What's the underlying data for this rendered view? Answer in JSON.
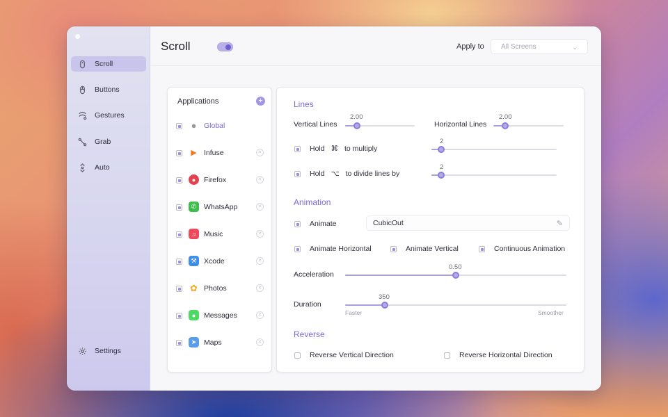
{
  "sidebar": {
    "items": [
      {
        "label": "Scroll",
        "icon": "mouse-icon",
        "active": true
      },
      {
        "label": "Buttons",
        "icon": "mouse-button-icon",
        "active": false
      },
      {
        "label": "Gestures",
        "icon": "gesture-icon",
        "active": false
      },
      {
        "label": "Grab",
        "icon": "grab-icon",
        "active": false
      },
      {
        "label": "Auto",
        "icon": "auto-scroll-icon",
        "active": false
      }
    ],
    "settings": {
      "label": "Settings",
      "icon": "gear-icon"
    }
  },
  "header": {
    "title": "Scroll",
    "enabled": true,
    "apply_to_label": "Apply to",
    "apply_to_value": "All Screens"
  },
  "applications": {
    "title": "Applications",
    "items": [
      {
        "name": "Global",
        "checked": true,
        "selected": true,
        "icon": "apple-icon",
        "color": "#9a9aa2"
      },
      {
        "name": "Infuse",
        "checked": true,
        "selected": false,
        "icon": "infuse-icon",
        "color": "#f07a24"
      },
      {
        "name": "Firefox",
        "checked": true,
        "selected": false,
        "icon": "firefox-icon",
        "color": "#e3414f"
      },
      {
        "name": "WhatsApp",
        "checked": true,
        "selected": false,
        "icon": "whatsapp-icon",
        "color": "#3ebd4c"
      },
      {
        "name": "Music",
        "checked": true,
        "selected": false,
        "icon": "music-icon",
        "color": "#f04a5a"
      },
      {
        "name": "Xcode",
        "checked": true,
        "selected": false,
        "icon": "xcode-icon",
        "color": "#3f8ee8"
      },
      {
        "name": "Photos",
        "checked": true,
        "selected": false,
        "icon": "photos-icon",
        "color": "#f5a623"
      },
      {
        "name": "Messages",
        "checked": true,
        "selected": false,
        "icon": "messages-icon",
        "color": "#4cd964"
      },
      {
        "name": "Maps",
        "checked": true,
        "selected": false,
        "icon": "maps-icon",
        "color": "#5a9de8"
      }
    ]
  },
  "lines": {
    "section_title": "Lines",
    "vertical": {
      "label": "Vertical Lines",
      "value": "2.00",
      "fraction": 0.17
    },
    "horizontal": {
      "label": "Horizontal Lines",
      "value": "2.00",
      "fraction": 0.17
    },
    "hold_multiply": {
      "hold": "Hold",
      "key": "⌘",
      "rest": "to multiply",
      "value": "2",
      "fraction": 0.08,
      "checked": true
    },
    "hold_divide": {
      "hold": "Hold",
      "key": "⌥",
      "rest": "to divide lines by",
      "value": "2",
      "fraction": 0.08,
      "checked": true
    }
  },
  "animation": {
    "section_title": "Animation",
    "animate": {
      "label": "Animate",
      "checked": true,
      "curve": "CubicOut"
    },
    "animate_horizontal": {
      "label": "Animate Horizontal",
      "checked": true
    },
    "animate_vertical": {
      "label": "Animate Vertical",
      "checked": true
    },
    "continuous": {
      "label": "Continuous Animation",
      "checked": true
    },
    "acceleration": {
      "label": "Acceleration",
      "value": "0.50",
      "fraction": 0.5
    },
    "duration": {
      "label": "Duration",
      "value": "350",
      "fraction": 0.18,
      "min_label": "Faster",
      "max_label": "Smoother"
    }
  },
  "reverse": {
    "section_title": "Reverse",
    "vertical": {
      "label": "Reverse Vertical Direction",
      "checked": false
    },
    "horizontal": {
      "label": "Reverse Horizontal Direction",
      "checked": false
    }
  },
  "colors": {
    "accent": "#7a6bd6",
    "slider_fill": "#a89fe2",
    "sidebar_active": "#c9c4ec"
  }
}
